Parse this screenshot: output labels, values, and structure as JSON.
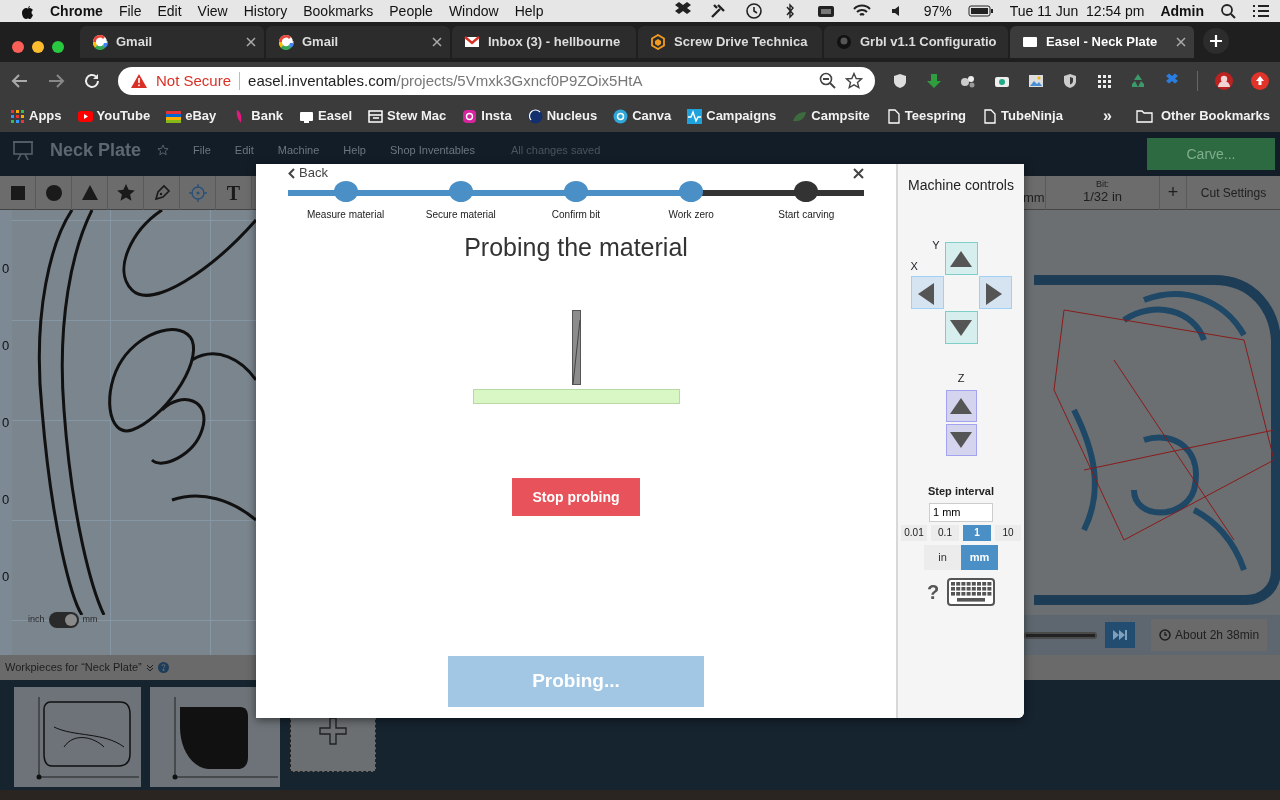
{
  "menubar": {
    "app": "Chrome",
    "menus": [
      "File",
      "Edit",
      "View",
      "History",
      "Bookmarks",
      "People",
      "Window",
      "Help"
    ],
    "battery": "97%",
    "clock": "Tue 11 Jun  12:54 pm",
    "user": "Admin"
  },
  "tabs": [
    {
      "title": "Gmail",
      "selected": false
    },
    {
      "title": "Gmail",
      "selected": false
    },
    {
      "title": "Inbox (3) - hellbourne",
      "selected": false
    },
    {
      "title": "Screw Drive Technica",
      "selected": false
    },
    {
      "title": "Grbl v1.1 Configuratio",
      "selected": false
    },
    {
      "title": "Easel - Neck Plate",
      "selected": true
    }
  ],
  "address_bar": {
    "security": "Not Secure",
    "host": "easel.inventables.com",
    "path": "/projects/5Vmxk3Gxncf0P9ZOix5HtA"
  },
  "bookmarks": [
    "Apps",
    "YouTube",
    "eBay",
    "Bank",
    "Easel",
    "Stew Mac",
    "Insta",
    "Nucleus",
    "Canva",
    "Campaigns",
    "Campsite",
    "Teespring",
    "TubeNinja"
  ],
  "bookmarks_overflow": "»",
  "other_bookmarks": "Other Bookmarks",
  "app": {
    "project": "Neck Plate",
    "menus": [
      "File",
      "Edit",
      "Machine",
      "Help",
      "Shop Inventables"
    ],
    "save_status": "All changes saved",
    "carve": "Carve..."
  },
  "toolbar": {
    "text_tool": "T",
    "units": "mm",
    "bit_label": "Bit:",
    "bit": "1/32 in",
    "add": "+",
    "cut_settings": "Cut Settings"
  },
  "canvas": {
    "ruler_labels": [
      "0",
      "0",
      "0",
      "0",
      "0"
    ],
    "unit_imperial": "inch",
    "unit_metric": "mm",
    "metric": true
  },
  "preview": {
    "slider": {
      "level": 1
    },
    "estimate": "About 2h 38min"
  },
  "workpieces": {
    "title": "Workpieces for “Neck Plate”"
  },
  "wizard": {
    "back": "Back",
    "steps": [
      {
        "label": "Measure material",
        "done": true
      },
      {
        "label": "Secure material",
        "done": true
      },
      {
        "label": "Confirm bit",
        "done": true
      },
      {
        "label": "Work zero",
        "done": true
      },
      {
        "label": "Start carving",
        "done": false
      }
    ],
    "title": "Probing the material",
    "stop": "Stop probing",
    "action": {
      "label": "Probing...",
      "disabled": true
    }
  },
  "machine_controls": {
    "title": "Machine controls",
    "axis_x": "X",
    "axis_y": "Y",
    "axis_z": "Z",
    "step_label": "Step interval",
    "step_value": "1 mm",
    "step_options": [
      {
        "label": "0.01",
        "selected": false
      },
      {
        "label": "0.1",
        "selected": false
      },
      {
        "label": "1",
        "selected": true
      },
      {
        "label": "10",
        "selected": false
      }
    ],
    "unit_options": [
      {
        "label": "in",
        "selected": false
      },
      {
        "label": "mm",
        "selected": true
      }
    ],
    "help": "?"
  }
}
